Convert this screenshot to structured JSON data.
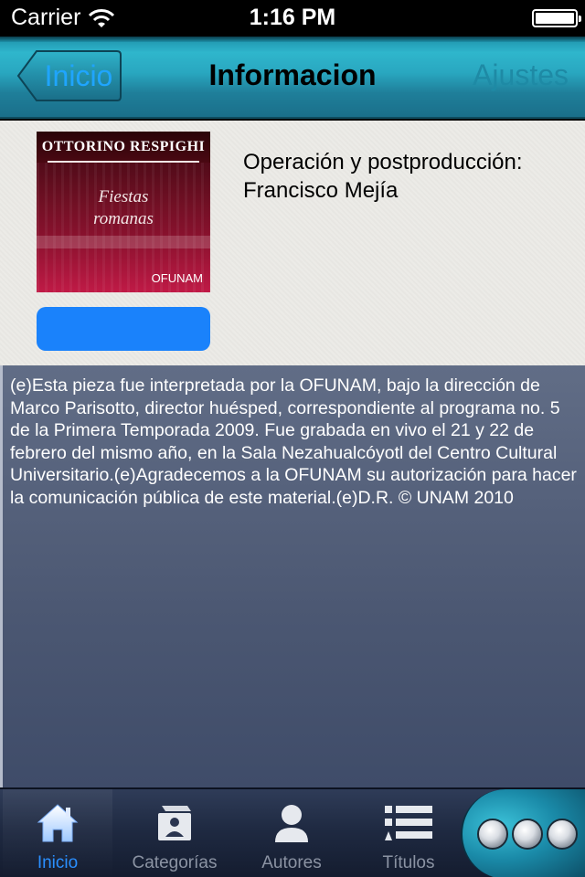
{
  "status_bar": {
    "carrier": "Carrier",
    "time": "1:16 PM"
  },
  "nav": {
    "back_label": "Inicio",
    "title": "Informacion",
    "settings_label": "Ajustes"
  },
  "album": {
    "composer": "OTTORINO RESPIGHI",
    "piece_line1": "Fiestas",
    "piece_line2": "romanas",
    "label": "OFUNAM"
  },
  "credits": "Operación y postproducción: Francisco Mejía",
  "description": "(e)Esta pieza fue interpretada por la OFUNAM, bajo la dirección de Marco Parisotto, director huésped, correspondiente al programa no. 5 de la Primera Temporada 2009. Fue grabada en vivo el 21 y 22 de febrero del mismo año, en la Sala Nezahualcóyotl del Centro Cultural Universitario.(e)Agradecemos a la OFUNAM su autorización para hacer la comunicación pública de este material.(e)D.R. © UNAM 2010",
  "tabs": [
    {
      "label": "Inicio",
      "icon": "home-icon",
      "active": true
    },
    {
      "label": "Categorías",
      "icon": "category-icon",
      "active": false
    },
    {
      "label": "Autores",
      "icon": "person-icon",
      "active": false
    },
    {
      "label": "Títulos",
      "icon": "list-icon",
      "active": false
    }
  ],
  "colors": {
    "accent": "#1a82fb",
    "active_tab": "#2a8fff",
    "panel": "#4b5772"
  }
}
